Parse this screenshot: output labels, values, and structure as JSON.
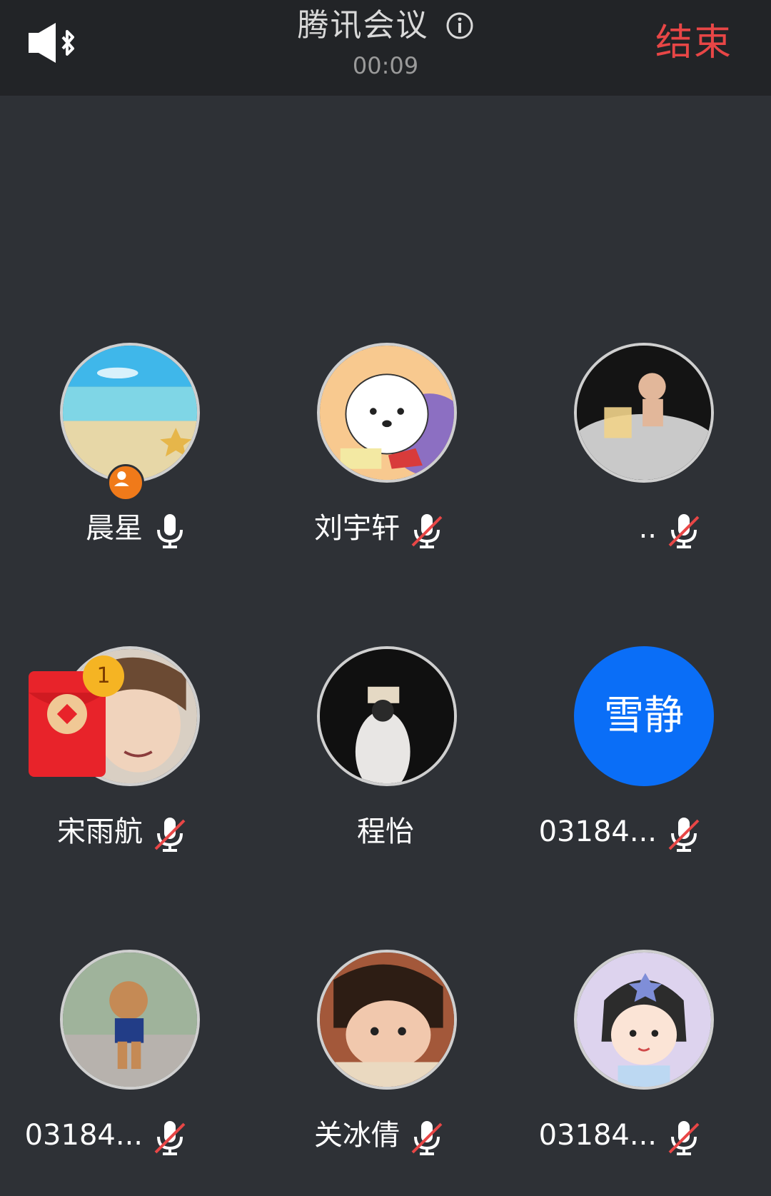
{
  "header": {
    "title": "腾讯会议",
    "timer": "00:09",
    "end_label": "结束",
    "speaker_icon": "bluetooth-speaker-icon",
    "info_icon": "info-icon"
  },
  "colors": {
    "background": "#2e3136",
    "topbar": "#222427",
    "end": "#e84646",
    "host_badge": "#f07a1a",
    "text_avatar": "#0a6ef7",
    "red_packet": "#e8232a",
    "mute_slash": "#e84646"
  },
  "participants": [
    {
      "name": "晨星",
      "mic": "on",
      "host": true,
      "avatar": "beach-photo"
    },
    {
      "name": "刘宇轩",
      "mic": "muted",
      "avatar": "cartoon-dog"
    },
    {
      "name": "..",
      "mic": "muted",
      "avatar": "woman-bath-photo"
    },
    {
      "name": "宋雨航",
      "mic": "muted",
      "avatar": "smiling-woman-photo"
    },
    {
      "name": "程怡",
      "mic": "none",
      "avatar": "girl-dark-photo"
    },
    {
      "name": "03184...",
      "mic": "muted",
      "avatar_text": "雪静"
    },
    {
      "name": "03184...",
      "mic": "muted",
      "avatar": "poodle-photo"
    },
    {
      "name": "关冰倩",
      "mic": "muted",
      "avatar": "child-photo"
    },
    {
      "name": "03184...",
      "mic": "muted",
      "avatar": "cartoon-girl"
    }
  ],
  "red_packet": {
    "badge_count": "1",
    "icon": "red-packet-icon"
  }
}
